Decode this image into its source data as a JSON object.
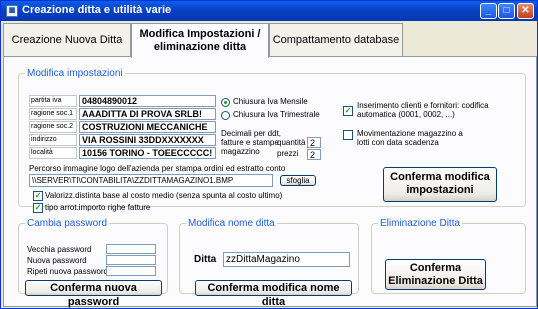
{
  "window": {
    "title": "Creazione ditta e utilità varie"
  },
  "tabs": [
    {
      "label": "Creazione Nuova Ditta"
    },
    {
      "label": "Modifica Impostazioni / eliminazione ditta"
    },
    {
      "label": "Compattamento database"
    }
  ],
  "settings": {
    "legend": "Modifica impostazioni",
    "rows": [
      {
        "label": "partita iva",
        "value": "04804890012"
      },
      {
        "label": "ragione soc.1",
        "value": "AAADITTA DI PROVA SRLB!"
      },
      {
        "label": "ragione soc.2",
        "value": "COSTRUZIONI MECCANICHE"
      },
      {
        "label": "indirizzo",
        "value": "VIA ROSSINI 33DDXXXXXXX"
      },
      {
        "label": "località",
        "value": "10156 TORINO - TOEECCCCC!"
      }
    ],
    "iva_monthly": "Chiusura Iva Mensile",
    "iva_quarterly": "Chiusura Iva Trimestrale",
    "decimals_label": "Decimali per ddt, fatture e stampe magazzino",
    "quantity_label": "quantità",
    "quantity_value": "2",
    "prices_label": "prezzi",
    "prices_value": "2",
    "auto_code_label": "Inserimento clienti e fornitori: codifica automatica (0001, 0002, ...)",
    "lots_label": "Movimentazione magazzino a lotti con data scadenza",
    "logo_path_label": "Percorso immagine logo dell'azienda per stampa ordini ed estratto conto",
    "logo_path_value": "\\\\SERVER\\TI\\CONTABILITA\\ZZDITTAMAGAZINO1.BMP",
    "browse_label": "sfoglia",
    "avg_cost_label": "Valorizz.distinta base al costo medio (senza spunta al costo ultimo)",
    "rounding_label": "tipo arrot.importo righe fatture",
    "confirm_label": "Conferma modifica impostazioni"
  },
  "password": {
    "legend": "Cambia password",
    "old_label": "Vecchia password",
    "new_label": "Nuova password",
    "repeat_label": "Ripeti nuova password",
    "confirm_label": "Conferma nuova password"
  },
  "rename": {
    "legend": "Modifica nome ditta",
    "ditta_label": "Ditta",
    "ditta_value": "zzDittaMagazino",
    "confirm_label": "Conferma modifica nome ditta"
  },
  "delete": {
    "legend": "Eliminazione Ditta",
    "confirm_label": "Conferma Eliminazione Ditta"
  }
}
